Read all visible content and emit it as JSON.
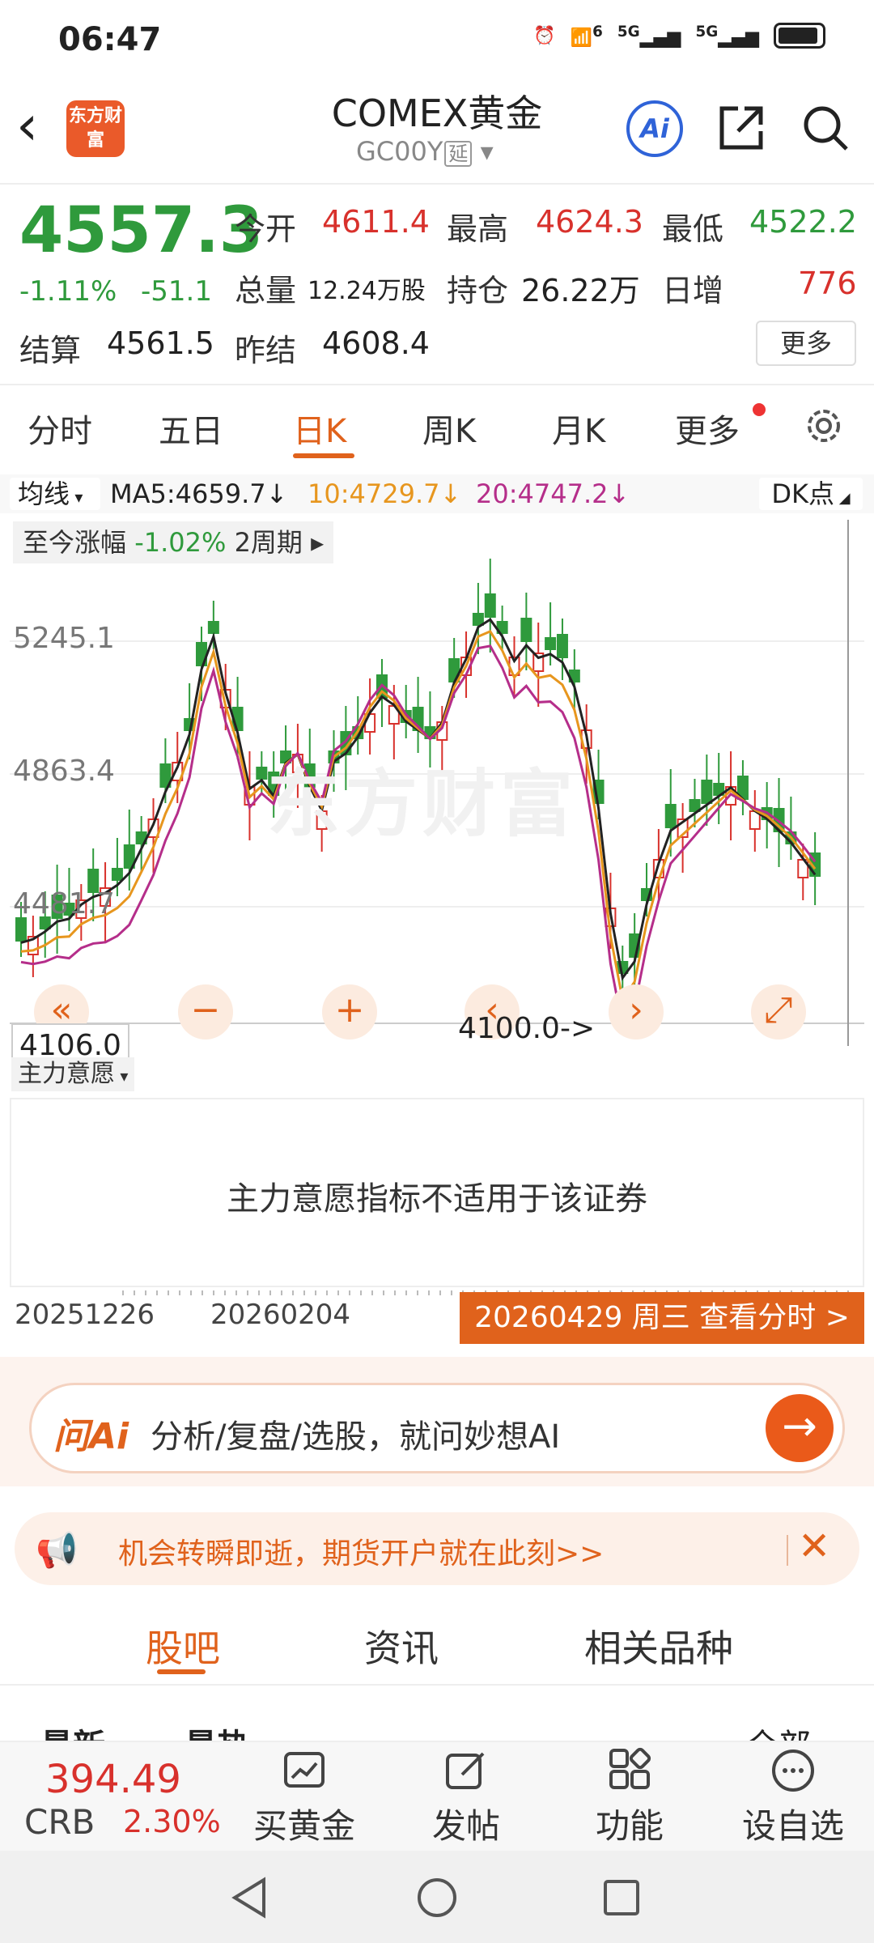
{
  "status_bar": {
    "time": "06:47",
    "signal_1": "5G",
    "signal_2": "5G",
    "wifi_badge": "6"
  },
  "header": {
    "app_logo": "东方财富",
    "title": "COMEX黄金",
    "code": "GC00Y",
    "delay_tag": "延",
    "ai_label": "Ai"
  },
  "quote": {
    "price": "4557.3",
    "change_pct": "-1.11%",
    "change_abs": "-51.1",
    "open_label": "今开",
    "open": "4611.4",
    "high_label": "最高",
    "high": "4624.3",
    "low_label": "最低",
    "low": "4522.2",
    "volume_label": "总量",
    "volume": "12.24万股",
    "oi_label": "持仓",
    "open_interest": "26.22万",
    "daily_inc_label": "日增",
    "daily_inc": "776",
    "settle_label": "结算",
    "settle": "4561.5",
    "prev_settle_label": "昨结",
    "prev_settle": "4608.4",
    "more_label": "更多"
  },
  "period_tabs": [
    "分时",
    "五日",
    "日K",
    "周K",
    "月K",
    "更多"
  ],
  "active_period": "日K",
  "ma_legend": {
    "selector": "均线",
    "ma5": "MA5:4659.7",
    "ma10": "10:4729.7",
    "ma20": "20:4747.2",
    "dk": "DK点",
    "colors": {
      "ma5": "#222222",
      "ma10": "#e7961e",
      "ma20": "#b52e8a"
    }
  },
  "chart": {
    "range_chip": "至今涨幅",
    "range_pct": "-1.02%",
    "range_period": "2周期",
    "y_labels": [
      "5245.1",
      "4863.4",
      "4481.7"
    ],
    "watermark": "东方财富",
    "low_marker": "4100.0->",
    "cursor_price": "4106.0",
    "controls": [
      "«",
      "−",
      "+",
      "‹",
      "›",
      "⤢"
    ]
  },
  "indicator": {
    "selector": "主力意愿",
    "message": "主力意愿指标不适用于该证券"
  },
  "date_axis": {
    "start": "20251226",
    "mid": "20260204",
    "cursor": "20260429 周三 查看分时 >"
  },
  "ai_bar": {
    "logo": "问Ai",
    "placeholder": "分析/复盘/选股，就问妙想AI",
    "go": "→"
  },
  "promo": {
    "text": "机会转瞬即逝，期货开户就在此刻>>"
  },
  "section_tabs": [
    "股吧",
    "资讯",
    "相关品种"
  ],
  "sub_tabs": {
    "latest": "最新",
    "hot": "最热",
    "all": "全部"
  },
  "bottom_bar": {
    "ticker_value": "394.49",
    "ticker_name": "CRB",
    "ticker_pct": "2.30%",
    "items": [
      "买黄金",
      "发帖",
      "功能",
      "设自选"
    ]
  }
}
